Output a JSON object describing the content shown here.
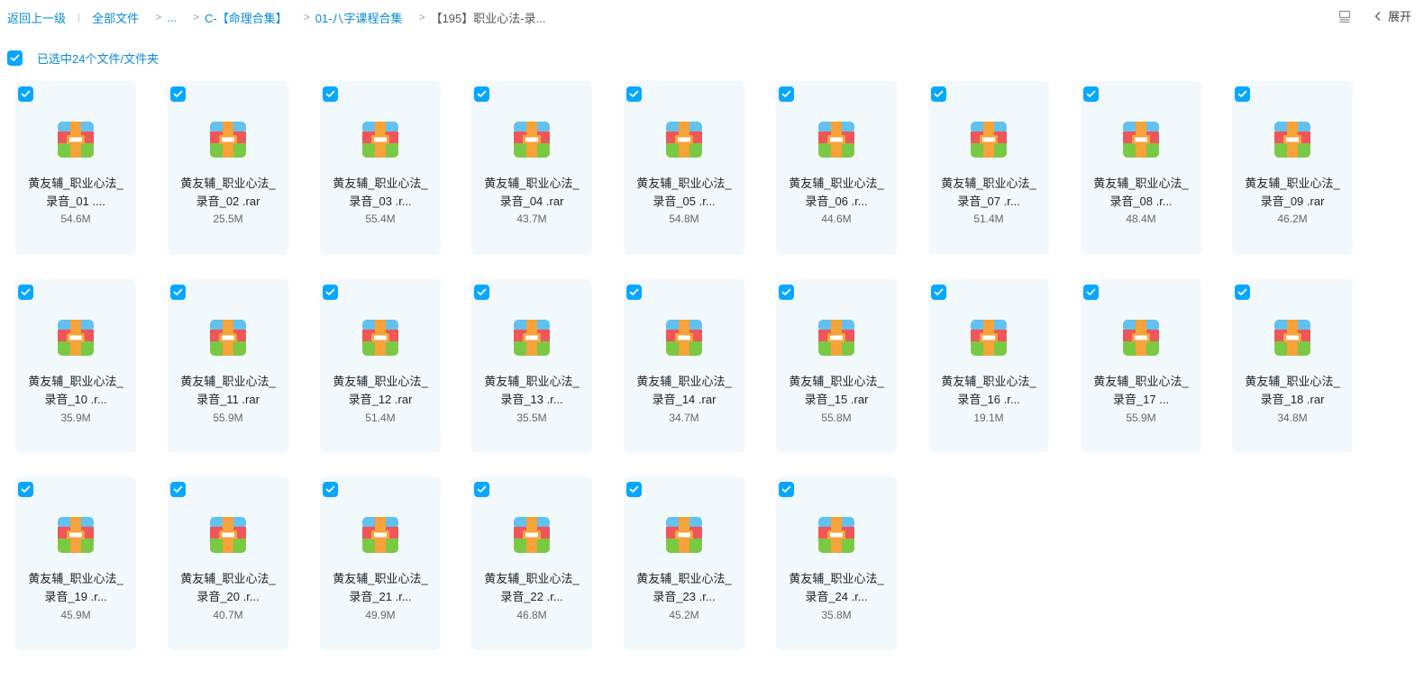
{
  "breadcrumb": {
    "back": "返回上一级",
    "all_files": "全部文件",
    "ellipsis": "...",
    "level1": "C-【命理合集】",
    "level2": "01-八字课程合集",
    "current": "【195】职业心法-录..."
  },
  "toolbar": {
    "expand_label": "展开"
  },
  "selection": {
    "label": "已选中24个文件/文件夹"
  },
  "colors": {
    "accent": "#06a7ff",
    "card_bg": "#f2f9fd"
  },
  "files": [
    {
      "name_line1": "黄友辅_职业心法_",
      "name_line2": "录音_01 ....",
      "size": "54.6M",
      "icon": "rar-archive-icon"
    },
    {
      "name_line1": "黄友辅_职业心法_",
      "name_line2": "录音_02 .rar",
      "size": "25.5M",
      "icon": "rar-archive-icon"
    },
    {
      "name_line1": "黄友辅_职业心法_",
      "name_line2": "录音_03 .r...",
      "size": "55.4M",
      "icon": "rar-archive-icon"
    },
    {
      "name_line1": "黄友辅_职业心法_",
      "name_line2": "录音_04 .rar",
      "size": "43.7M",
      "icon": "rar-archive-icon"
    },
    {
      "name_line1": "黄友辅_职业心法_",
      "name_line2": "录音_05 .r...",
      "size": "54.8M",
      "icon": "rar-archive-icon"
    },
    {
      "name_line1": "黄友辅_职业心法_",
      "name_line2": "录音_06 .r...",
      "size": "44.6M",
      "icon": "rar-archive-icon"
    },
    {
      "name_line1": "黄友辅_职业心法_",
      "name_line2": "录音_07 .r...",
      "size": "51.4M",
      "icon": "rar-archive-icon"
    },
    {
      "name_line1": "黄友辅_职业心法_",
      "name_line2": "录音_08 .r...",
      "size": "48.4M",
      "icon": "rar-archive-icon"
    },
    {
      "name_line1": "黄友辅_职业心法_",
      "name_line2": "录音_09 .rar",
      "size": "46.2M",
      "icon": "rar-archive-icon"
    },
    {
      "name_line1": "黄友辅_职业心法_",
      "name_line2": "录音_10 .r...",
      "size": "35.9M",
      "icon": "rar-archive-icon"
    },
    {
      "name_line1": "黄友辅_职业心法_",
      "name_line2": "录音_11 .rar",
      "size": "55.9M",
      "icon": "rar-archive-icon"
    },
    {
      "name_line1": "黄友辅_职业心法_",
      "name_line2": "录音_12 .rar",
      "size": "51.4M",
      "icon": "rar-archive-icon"
    },
    {
      "name_line1": "黄友辅_职业心法_",
      "name_line2": "录音_13 .r...",
      "size": "35.5M",
      "icon": "rar-archive-icon"
    },
    {
      "name_line1": "黄友辅_职业心法_",
      "name_line2": "录音_14 .rar",
      "size": "34.7M",
      "icon": "rar-archive-icon"
    },
    {
      "name_line1": "黄友辅_职业心法_",
      "name_line2": "录音_15 .rar",
      "size": "55.8M",
      "icon": "rar-archive-icon"
    },
    {
      "name_line1": "黄友辅_职业心法_",
      "name_line2": "录音_16 .r...",
      "size": "19.1M",
      "icon": "rar-archive-icon"
    },
    {
      "name_line1": "黄友辅_职业心法_",
      "name_line2": "录音_17 ...",
      "size": "55.9M",
      "icon": "rar-archive-icon"
    },
    {
      "name_line1": "黄友辅_职业心法_",
      "name_line2": "录音_18 .rar",
      "size": "34.8M",
      "icon": "rar-archive-icon"
    },
    {
      "name_line1": "黄友辅_职业心法_",
      "name_line2": "录音_19 .r...",
      "size": "45.9M",
      "icon": "rar-archive-icon"
    },
    {
      "name_line1": "黄友辅_职业心法_",
      "name_line2": "录音_20 .r...",
      "size": "40.7M",
      "icon": "rar-archive-icon"
    },
    {
      "name_line1": "黄友辅_职业心法_",
      "name_line2": "录音_21 .r...",
      "size": "49.9M",
      "icon": "rar-archive-icon"
    },
    {
      "name_line1": "黄友辅_职业心法_",
      "name_line2": "录音_22 .r...",
      "size": "46.8M",
      "icon": "rar-archive-icon"
    },
    {
      "name_line1": "黄友辅_职业心法_",
      "name_line2": "录音_23 .r...",
      "size": "45.2M",
      "icon": "rar-archive-icon"
    },
    {
      "name_line1": "黄友辅_职业心法_",
      "name_line2": "录音_24 .r...",
      "size": "35.8M",
      "icon": "rar-archive-icon"
    }
  ]
}
